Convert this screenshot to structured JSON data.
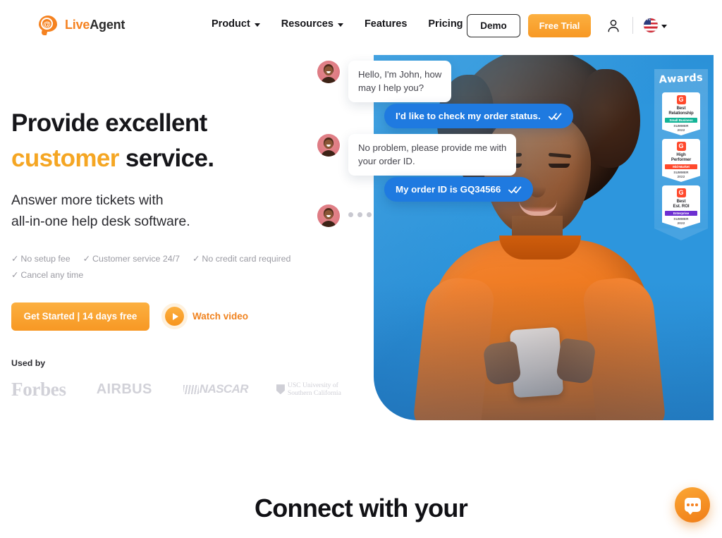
{
  "header": {
    "logo": {
      "mark": "at-speech-bubble-icon",
      "text_primary": "Live",
      "text_secondary": "Agent"
    },
    "nav": [
      {
        "label": "Product",
        "has_dropdown": true
      },
      {
        "label": "Resources",
        "has_dropdown": true
      },
      {
        "label": "Features",
        "has_dropdown": false
      },
      {
        "label": "Pricing",
        "has_dropdown": false
      }
    ],
    "demo_button": "Demo",
    "trial_button": "Free Trial",
    "account_icon": "user-icon",
    "language": {
      "flag": "us-flag-icon",
      "chevron": "chevron-down-icon"
    }
  },
  "hero": {
    "heading_line1": "Provide excellent",
    "heading_accent": "customer",
    "heading_rest": " service.",
    "subheading_line1": "Answer more tickets with",
    "subheading_line2": "all-in-one help desk software.",
    "trust_items": [
      "No setup fee",
      "Customer service 24/7",
      "No credit card required",
      "Cancel any time"
    ],
    "tick_glyph": "✓",
    "cta_primary": "Get Started | 14 days free",
    "watch_video": "Watch video",
    "play_icon": "play-icon",
    "used_by_label": "Used by",
    "brands": [
      {
        "name": "Forbes"
      },
      {
        "name": "AIRBUS"
      },
      {
        "name": "NASCAR"
      },
      {
        "name": "USC University of",
        "name2": "Southern California"
      }
    ]
  },
  "chat": {
    "messages": [
      {
        "side": "in",
        "text": "Hello, I'm John, how",
        "text2": "may I help you?",
        "avatar": true
      },
      {
        "side": "out",
        "text": "I'd like to check my order status.",
        "ticks": true
      },
      {
        "side": "in",
        "text": "No problem, please provide me with",
        "text2": "your order ID.",
        "avatar": true
      },
      {
        "side": "out",
        "text": "My order ID is GQ34566",
        "ticks": true
      },
      {
        "side": "typing",
        "avatar": true
      }
    ]
  },
  "awards": {
    "title": "Awards",
    "badges": [
      {
        "logo": "G",
        "name_line1": "Best",
        "name_line2": "Relationship",
        "category": "Small Business",
        "category_color": "#13b497",
        "season": "SUMMER",
        "year": "2022"
      },
      {
        "logo": "G",
        "name_line1": "High",
        "name_line2": "Performer",
        "category": "Mid-Market",
        "category_color": "#ff492c",
        "season": "SUMMER",
        "year": "2022"
      },
      {
        "logo": "G",
        "name_line1": "Best",
        "name_line2": "Est. ROI",
        "category": "Enterprise",
        "category_color": "#6d2fd1",
        "season": "SUMMER",
        "year": "2022"
      }
    ]
  },
  "section2": {
    "heading": "Connect with your"
  },
  "widget": {
    "icon": "chat-bubble-icon"
  },
  "colors": {
    "brand_orange": "#f58220",
    "accent_yellow": "#f5a623",
    "chat_blue": "#1f7ae0",
    "hero_blue": "#2d96dd",
    "text_dark": "#16161a",
    "muted": "#9b9ba3"
  }
}
